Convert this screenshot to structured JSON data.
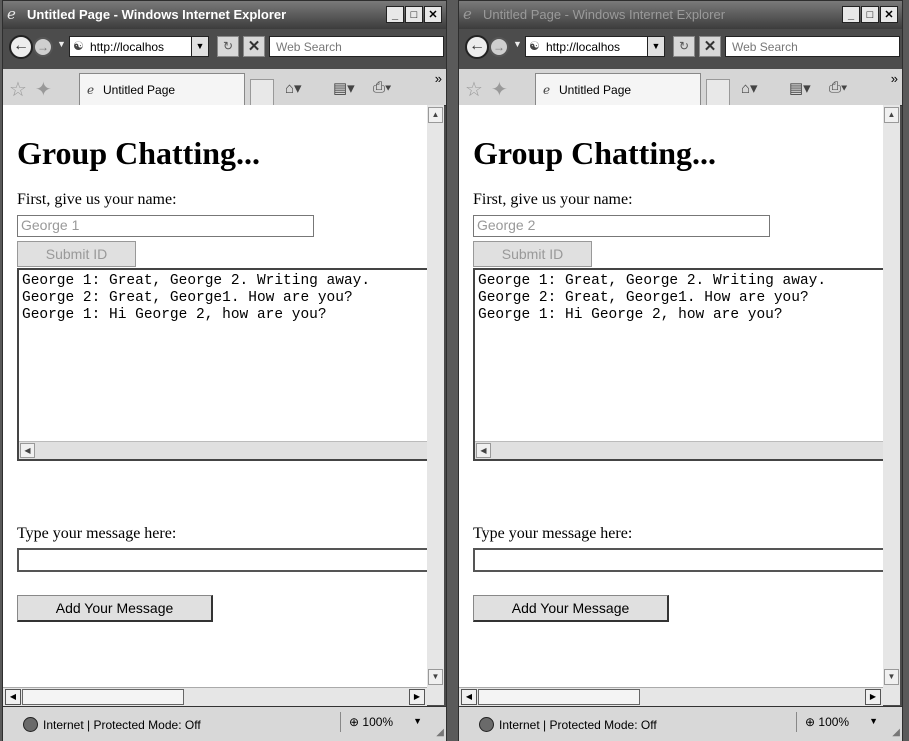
{
  "windows": [
    {
      "title": "Untitled Page - Windows Internet Explorer",
      "active": true,
      "address": "http://localhos",
      "search_placeholder": "Web Search",
      "tab_label": "Untitled Page",
      "heading": "Group Chatting...",
      "name_prompt": "First, give us your name:",
      "name_value": "George 1",
      "submit_label": "Submit ID",
      "chat_lines": [
        "George 1: Great, George 2. Writing away.",
        "George 2: Great, George1. How are you?",
        "George 1: Hi George 2, how are you?"
      ],
      "message_prompt": "Type your message here:",
      "message_value": "",
      "add_label": "Add Your Message",
      "status": "Internet | Protected Mode: Off",
      "zoom": "100%"
    },
    {
      "title": "Untitled Page - Windows Internet Explorer",
      "active": false,
      "address": "http://localhos",
      "search_placeholder": "Web Search",
      "tab_label": "Untitled Page",
      "heading": "Group Chatting...",
      "name_prompt": "First, give us your name:",
      "name_value": "George 2",
      "submit_label": "Submit ID",
      "chat_lines": [
        "George 1: Great, George 2. Writing away.",
        "George 2: Great, George1. How are you?",
        "George 1: Hi George 2, how are you?"
      ],
      "message_prompt": "Type your message here:",
      "message_value": "",
      "add_label": "Add Your Message",
      "status": "Internet | Protected Mode: Off",
      "zoom": "100%"
    }
  ],
  "caption_buttons": {
    "minimize": "_",
    "maximize": "□",
    "close": "✕"
  },
  "icons": [
    "ie-logo-icon",
    "back-icon",
    "forward-icon",
    "refresh-icon",
    "stop-icon",
    "favorites-star-icon",
    "add-favorites-icon",
    "home-icon",
    "rss-feed-icon",
    "print-icon",
    "globe-icon",
    "zoom-icon"
  ]
}
